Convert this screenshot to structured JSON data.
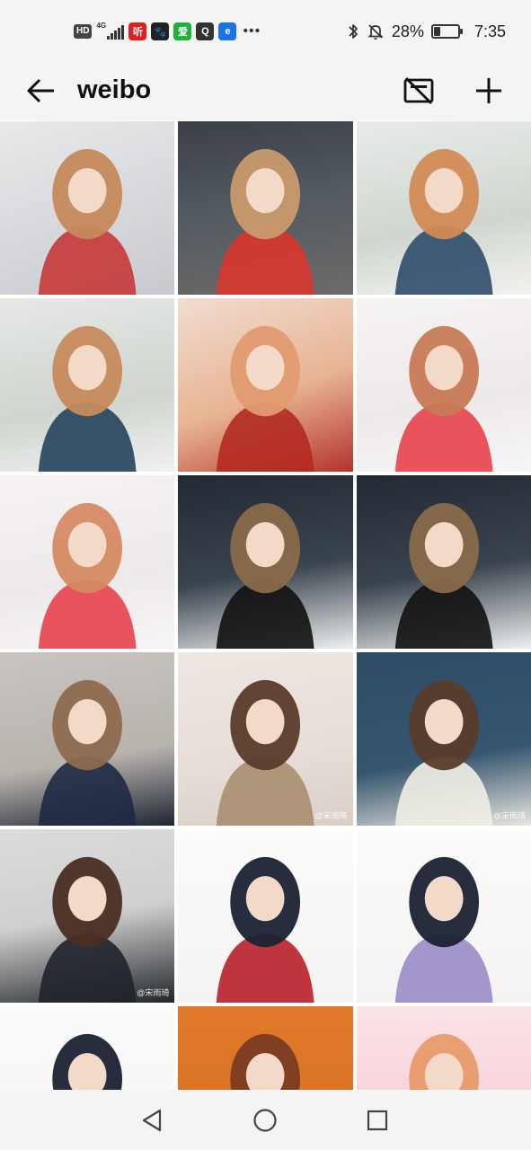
{
  "status_bar": {
    "hd_badge": "HD",
    "network": "4G",
    "apps": [
      {
        "name": "ting-app-icon",
        "glyph": "听",
        "color": "#e02020"
      },
      {
        "name": "pet-app-icon",
        "glyph": "🐾",
        "color": "#222222"
      },
      {
        "name": "iqiyi-app-icon",
        "glyph": "爱",
        "color": "#1db33b"
      },
      {
        "name": "qq-app-icon",
        "glyph": "Q",
        "color": "#333333"
      },
      {
        "name": "browser-app-icon",
        "glyph": "e",
        "color": "#1a73e8"
      }
    ],
    "more": "•••",
    "battery_percent": "28%",
    "battery_level": 0.28,
    "time": "7:35"
  },
  "app_bar": {
    "title": "weibo"
  },
  "grid": {
    "columns": 3,
    "tiles": [
      {
        "bg": "linear-gradient(160deg,#e9e9ea 0%,#d7d8dc 55%,#c8c9cf 100%)",
        "accent": "#c63838",
        "hair": "#c58a5a",
        "watermark": ""
      },
      {
        "bg": "linear-gradient(170deg,#3b3f48 0%,#545b62 50%,#6e6a68 100%)",
        "accent": "#d9362c",
        "hair": "#c99a6b",
        "watermark": ""
      },
      {
        "bg": "linear-gradient(170deg,#e8ebe9 0%,#cfd6cf 60%,#f3f3f0 100%)",
        "accent": "#2d4c6a",
        "hair": "#d38a55",
        "watermark": ""
      },
      {
        "bg": "linear-gradient(170deg,#e6e8e6 0%,#cfd5cf 60%,#f1f1ef 100%)",
        "accent": "#23445c",
        "hair": "#c78a5c",
        "watermark": ""
      },
      {
        "bg": "linear-gradient(160deg,#f1ddd1 0%,#e8b493 55%,#b3332c 100%)",
        "accent": "#b32a22",
        "hair": "#e39b71",
        "watermark": ""
      },
      {
        "bg": "linear-gradient(170deg,#f6f3f3 0%,#eeeaea 60%,#f7f5f5 100%)",
        "accent": "#e8424b",
        "hair": "#c77a55",
        "watermark": ""
      },
      {
        "bg": "linear-gradient(170deg,#f7f3f3 0%,#efeaea 60%,#f7f5f5 100%)",
        "accent": "#e8424b",
        "hair": "#d58a63",
        "watermark": ""
      },
      {
        "bg": "linear-gradient(170deg,#222a33 0%,#3a444e 55%,#eef0f0 100%)",
        "accent": "#111111",
        "hair": "#8a6a4a",
        "watermark": ""
      },
      {
        "bg": "linear-gradient(170deg,#222a33 0%,#3a444e 55%,#eef0f0 100%)",
        "accent": "#111111",
        "hair": "#8a6a4a",
        "watermark": ""
      },
      {
        "bg": "linear-gradient(170deg,#c9c4c0 0%,#b9b3ae 60%,#1f2633 100%)",
        "accent": "#1e2a44",
        "hair": "#8d6a4f",
        "watermark": ""
      },
      {
        "bg": "linear-gradient(170deg,#efe7e3 0%,#e6ddd8 60%,#d9cfc6 100%)",
        "accent": "#a88e70",
        "hair": "#5a3b2a",
        "watermark": "@宋雨琦"
      },
      {
        "bg": "linear-gradient(170deg,#2f4b66 0%,#36566f 60%,#e9e6df 100%)",
        "accent": "#f1eee6",
        "hair": "#5a3c2b",
        "watermark": "@宋雨琦"
      },
      {
        "bg": "linear-gradient(170deg,#dcdcdc 0%,#cfcfcf 50%,#22262b 100%)",
        "accent": "#20242a",
        "hair": "#4a2e22",
        "watermark": "@宋雨琦"
      },
      {
        "bg": "linear-gradient(180deg,#fbfbfa 0%,#f5f3f1 100%)",
        "accent": "#b8202a",
        "hair": "#1b2233",
        "watermark": ""
      },
      {
        "bg": "linear-gradient(180deg,#fbfbfa 0%,#f5f3f1 100%)",
        "accent": "#9a8cc8",
        "hair": "#1b2233",
        "watermark": ""
      },
      {
        "bg": "linear-gradient(180deg,#fbfbfa 0%,#f5f3f1 100%)",
        "accent": "#e2c55a",
        "hair": "#1b2233",
        "watermark": ""
      },
      {
        "bg": "linear-gradient(180deg,#e07a2a 0%,#d66f22 100%)",
        "accent": "#1c2b4a",
        "hair": "#7a3b22",
        "watermark": ""
      },
      {
        "bg": "linear-gradient(180deg,#fbe3e6 0%,#f5c8d2 100%)",
        "accent": "#ef8eb0",
        "hair": "#e79b6a",
        "watermark": ""
      }
    ]
  }
}
